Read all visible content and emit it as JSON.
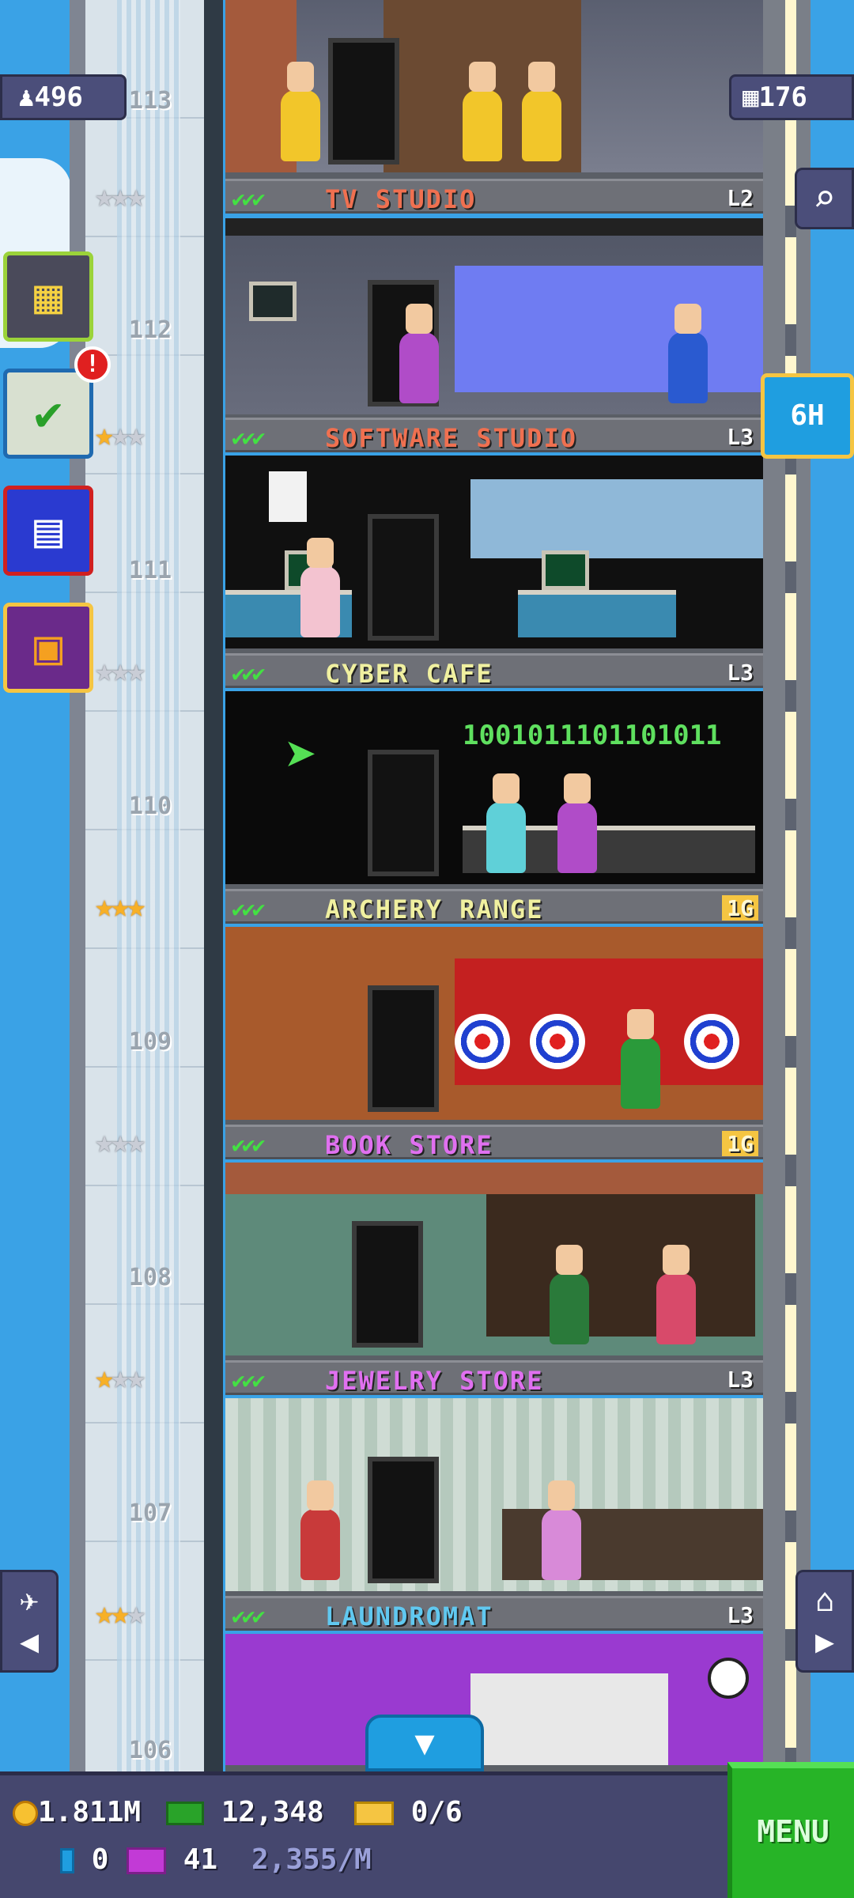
{
  "hud": {
    "population": "496",
    "floors": "176",
    "timer_label": "6H",
    "notification_count": "!"
  },
  "floors": [
    {
      "number": "113",
      "name": "TV STUDIO",
      "name_color": "#f07050",
      "level": "L2",
      "level_style": "plain",
      "stars": [
        "silver",
        "silver",
        "silver"
      ]
    },
    {
      "number": "112",
      "name": "SOFTWARE STUDIO",
      "name_color": "#f07050",
      "level": "L3",
      "level_style": "plain",
      "stars": [
        "gold",
        "silver",
        "silver"
      ]
    },
    {
      "number": "111",
      "name": "CYBER CAFE",
      "name_color": "#f0f0a0",
      "level": "L3",
      "level_style": "plain",
      "stars": [
        "silver",
        "silver",
        "silver"
      ]
    },
    {
      "number": "110",
      "name": "ARCHERY RANGE",
      "name_color": "#f0f0a0",
      "level": "1G",
      "level_style": "gold",
      "stars": [
        "gold",
        "gold",
        "gold"
      ]
    },
    {
      "number": "109",
      "name": "BOOK STORE",
      "name_color": "#e070f0",
      "level": "1G",
      "level_style": "gold",
      "stars": [
        "silver",
        "silver",
        "silver"
      ]
    },
    {
      "number": "108",
      "name": "JEWELRY STORE",
      "name_color": "#e070f0",
      "level": "L3",
      "level_style": "plain",
      "stars": [
        "gold",
        "silver",
        "silver"
      ]
    },
    {
      "number": "107",
      "name": "LAUNDROMAT",
      "name_color": "#60c8f0",
      "level": "L3",
      "level_style": "plain",
      "stars": [
        "gold",
        "gold",
        "silver"
      ]
    },
    {
      "number": "106",
      "name": "",
      "name_color": "#ffffff",
      "level": "",
      "level_style": "plain",
      "stars": []
    }
  ],
  "cyber_cafe_binary": "1001011101101011",
  "bottom_bar": {
    "coins": "1.811M",
    "bux_cash": "12,348",
    "tickets": "0/6",
    "tower_bux": "0",
    "vip": "41",
    "income_rate": "2,355/M",
    "menu_label": "MENU"
  },
  "icons": {
    "population": "person-icon",
    "floors": "building-icon",
    "search": "magnifier-icon",
    "build": "building-grid-icon",
    "missions": "checklist-icon",
    "calendar": "calendar-icon",
    "gift": "gift-icon",
    "elevator_left": "elevator-left-icon",
    "elevator_right": "home-right-icon",
    "scroll_down": "chevron-down-icon"
  }
}
